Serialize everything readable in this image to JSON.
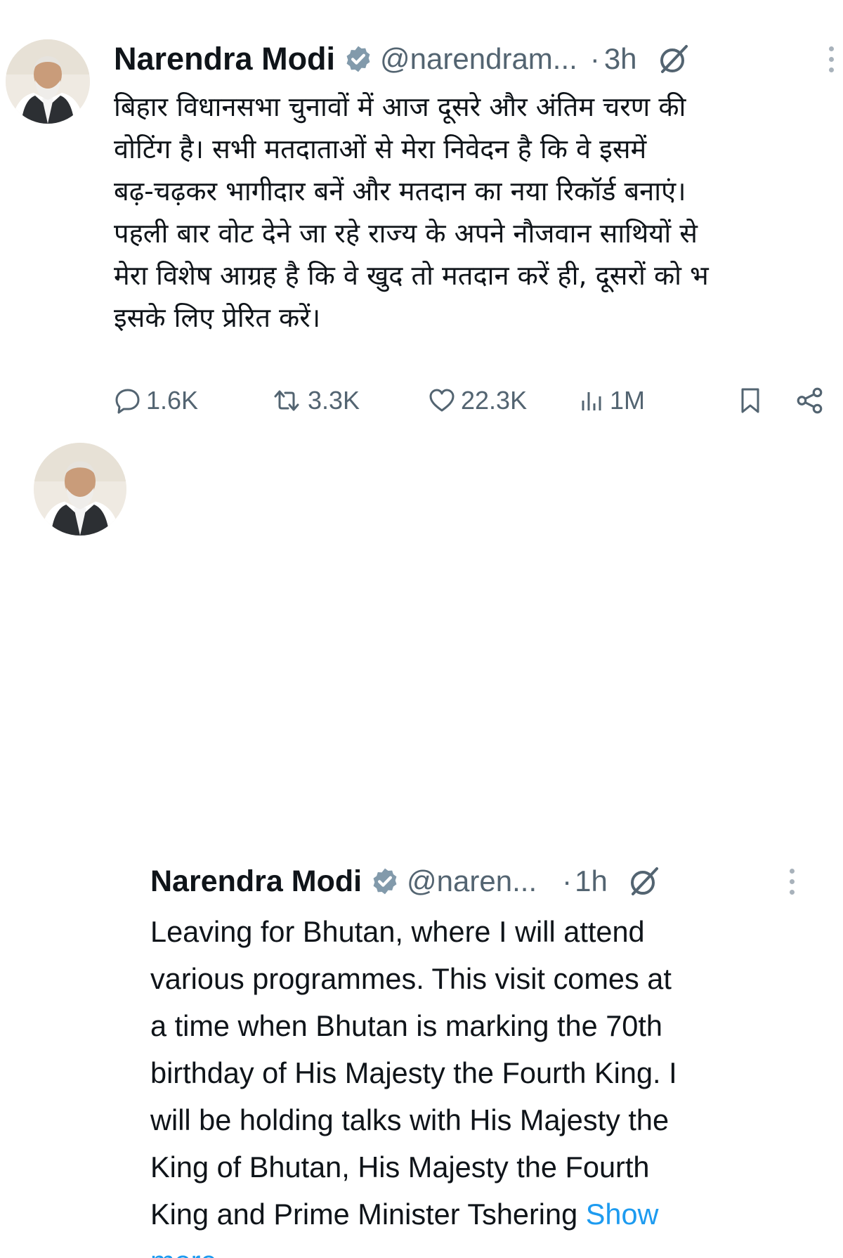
{
  "tweets": [
    {
      "display_name": "Narendra Modi",
      "handle": "@narendram...",
      "separator": "·",
      "time": "3h",
      "text": "बिहार विधानसभा चुनावों में आज दूसरे और अंतिम चरण की\nवोटिंग है। सभी मतदाताओं से मेरा निवेदन है कि वे इसमें\nबढ़-चढ़कर भागीदार बनें और मतदान का नया रिकॉर्ड बनाएं।\nपहली बार वोट देने जा रहे राज्य के अपने नौजवान साथियों से\nमेरा विशेष आग्रह है कि वे खुद तो मतदान करें ही, दूसरों को भ\nइसके लिए प्रेरित करें।",
      "stats": {
        "replies": "1.6K",
        "reposts": "3.3K",
        "likes": "22.3K",
        "views": "1M"
      },
      "icons": [
        "verified-badge-icon",
        "grok-icon",
        "more-icon",
        "reply-icon",
        "repost-icon",
        "like-icon",
        "views-icon",
        "bookmark-icon",
        "share-icon"
      ]
    },
    {
      "display_name": "Narendra Modi",
      "handle": "@naren...",
      "separator": "·",
      "time": "1h",
      "text": "Leaving for Bhutan, where I will attend\nvarious programmes. This visit comes at\na time when Bhutan is marking the 70th\nbirthday of His Majesty the Fourth King. I\nwill be holding talks with His Majesty the\nKing of Bhutan, His Majesty the Fourth\nKing and Prime Minister Tshering ",
      "show_more": "Show\nmore",
      "icons": [
        "verified-badge-icon",
        "grok-icon",
        "more-icon"
      ]
    }
  ],
  "colors": {
    "text": "#0f1419",
    "secondary": "#536471",
    "link": "#1d9bf0",
    "verified_badge": "#829aab"
  }
}
